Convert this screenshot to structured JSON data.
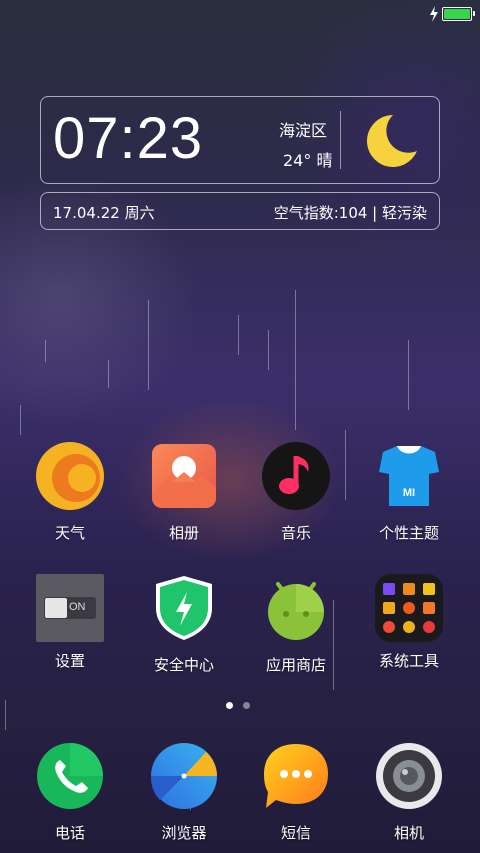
{
  "status_bar": {
    "battery_level": 1.0,
    "charging_icon": "bolt-icon",
    "battery_color": "#35d64a"
  },
  "clock_widget": {
    "time": "07:23",
    "location": "海淀区",
    "temperature_weather": "24° 晴",
    "weather_icon": "moon-icon",
    "date": "17.04.22 周六",
    "air_quality": "空气指数:104 | 轻污染"
  },
  "apps_row1": [
    {
      "label": "天气",
      "icon": "weather-icon"
    },
    {
      "label": "相册",
      "icon": "gallery-icon"
    },
    {
      "label": "音乐",
      "icon": "music-icon"
    },
    {
      "label": "个性主题",
      "icon": "themes-icon"
    }
  ],
  "apps_row2": [
    {
      "label": "设置",
      "icon": "settings-icon"
    },
    {
      "label": "安全中心",
      "icon": "security-icon"
    },
    {
      "label": "应用商店",
      "icon": "app-store-icon"
    },
    {
      "label": "系统工具",
      "icon": "system-tools-folder-icon"
    }
  ],
  "settings_toggle_text": "ON",
  "page_indicator": {
    "total": 2,
    "current": 1
  },
  "dock": [
    {
      "label": "电话",
      "icon": "phone-icon"
    },
    {
      "label": "浏览器",
      "icon": "browser-icon"
    },
    {
      "label": "短信",
      "icon": "messages-icon"
    },
    {
      "label": "相机",
      "icon": "camera-icon"
    }
  ]
}
